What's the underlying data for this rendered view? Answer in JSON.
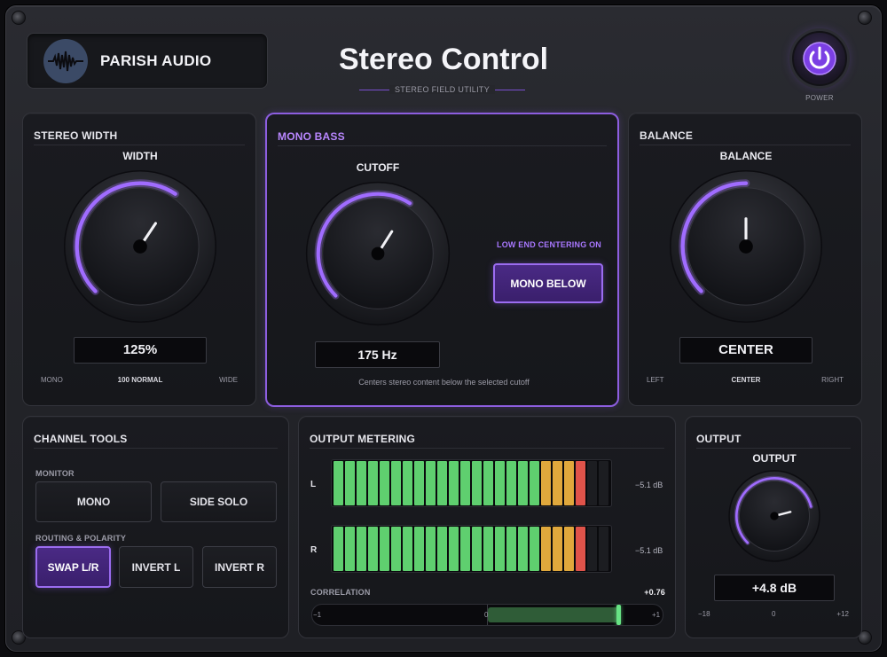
{
  "header": {
    "brand": "PARISH AUDIO",
    "title": "Stereo Control",
    "subtitle": "STEREO FIELD UTILITY",
    "power_label": "POWER"
  },
  "stereo_width": {
    "heading": "STEREO WIDTH",
    "knob_label": "WIDTH",
    "value": "125%",
    "scale_left": "MONO",
    "scale_center": "100 NORMAL",
    "scale_right": "WIDE",
    "amount_fraction": 0.625
  },
  "mono_bass": {
    "heading": "MONO BASS",
    "knob_label": "CUTOFF",
    "value": "175 Hz",
    "status": "LOW END CENTERING ON",
    "button": "MONO BELOW",
    "description": "Centers stereo content below the selected cutoff",
    "amount_fraction": 0.62
  },
  "balance": {
    "heading": "BALANCE",
    "knob_label": "BALANCE",
    "value": "CENTER",
    "scale_left": "LEFT",
    "scale_center": "CENTER",
    "scale_right": "RIGHT",
    "amount_fraction": 0.5
  },
  "channel_tools": {
    "heading": "CHANNEL TOOLS",
    "monitor_label": "MONITOR",
    "mono_button": "MONO",
    "side_solo_button": "SIDE SOLO",
    "routing_label": "ROUTING & POLARITY",
    "swap_button": "SWAP L/R",
    "invert_l_button": "INVERT L",
    "invert_r_button": "INVERT R"
  },
  "metering": {
    "heading": "OUTPUT METERING",
    "left_label": "L",
    "right_label": "R",
    "left_db": "−5.1 dB",
    "right_db": "−5.1 dB",
    "segments_total": 24,
    "segments_lit": 22,
    "green_count": 18,
    "amber_count": 3,
    "red_count": 1,
    "correlation_label": "CORRELATION",
    "correlation_value": "+0.76",
    "correlation": 0.76,
    "corr_min": "−1",
    "corr_mid": "0",
    "corr_max": "+1",
    "colors": {
      "green": "#5fcf6f",
      "amber": "#e0a83c",
      "red": "#e0534a",
      "off": "#1c1d21"
    }
  },
  "output": {
    "heading": "OUTPUT",
    "knob_label": "OUTPUT",
    "value": "+4.8 dB",
    "scale_min": "−18",
    "scale_mid": "0",
    "scale_max": "+12",
    "amount_fraction": 0.78
  },
  "accent": "#9b6cf0"
}
